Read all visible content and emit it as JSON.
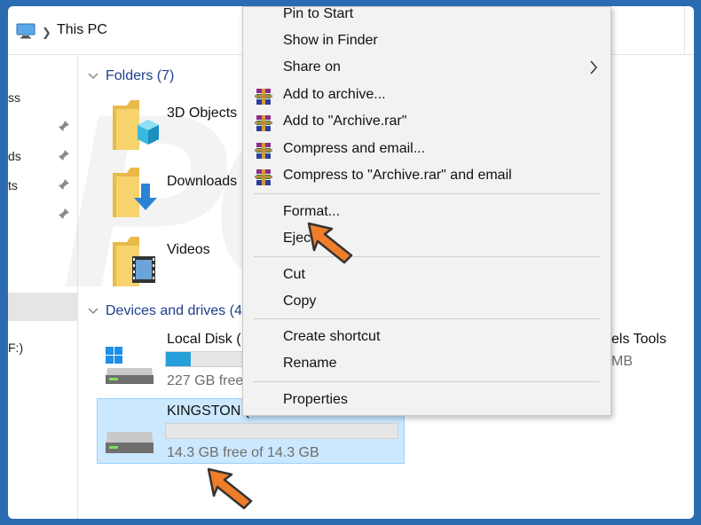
{
  "address": {
    "crumb": "This PC"
  },
  "nav": {
    "fragments": [
      "ss",
      "ds",
      "ts",
      "F:)"
    ]
  },
  "groups": {
    "folders_header": "Folders (7)",
    "devices_header": "Devices and drives (4"
  },
  "folders": [
    {
      "name": "3D Objects",
      "icon": "3d-objects-folder-icon"
    },
    {
      "name": "Downloads",
      "icon": "downloads-folder-icon"
    },
    {
      "name": "Videos",
      "icon": "videos-folder-icon"
    }
  ],
  "drives": [
    {
      "name": "Local Disk (",
      "free": "227 GB free",
      "used_fraction": 0.16
    },
    {
      "name": "KINGSTON (",
      "free": "14.3 GB free of 14.3 GB",
      "used_fraction": 0.0
    }
  ],
  "right_fragments": {
    "title": "els Tools",
    "size": "MB"
  },
  "context_menu": {
    "items": [
      {
        "label": "Pin to Start",
        "icon": ""
      },
      {
        "label": "Show in Finder",
        "icon": ""
      },
      {
        "label": "Share on",
        "icon": "",
        "submenu": true
      },
      {
        "label": "Add to archive...",
        "icon": "winrar-icon"
      },
      {
        "label": "Add to \"Archive.rar\"",
        "icon": "winrar-icon"
      },
      {
        "label": "Compress and email...",
        "icon": "winrar-icon"
      },
      {
        "label": "Compress to \"Archive.rar\" and email",
        "icon": "winrar-icon"
      },
      {
        "label": "Format...",
        "icon": ""
      },
      {
        "label": "Ejec",
        "icon": ""
      },
      {
        "label": "Cut",
        "icon": ""
      },
      {
        "label": "Copy",
        "icon": ""
      },
      {
        "label": "Create shortcut",
        "icon": ""
      },
      {
        "label": "Rename",
        "icon": ""
      },
      {
        "label": "Properties",
        "icon": ""
      }
    ]
  },
  "colors": {
    "frame_border": "#2b6cb0",
    "selection": "#cce8ff",
    "group_header": "#1e3f8a",
    "progress": "#26a0da",
    "arrow": "#f07d2a"
  }
}
